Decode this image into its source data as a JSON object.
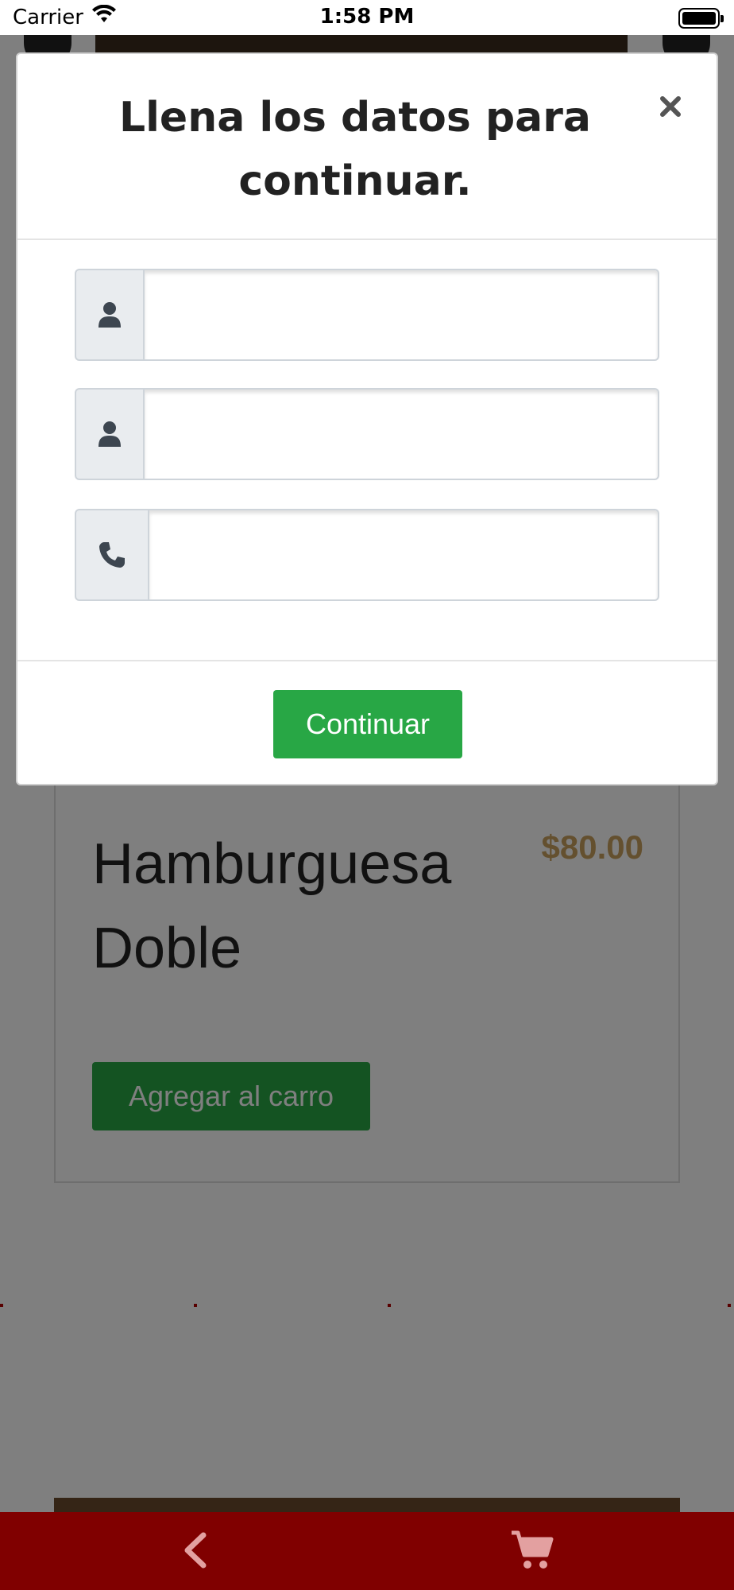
{
  "status_bar": {
    "carrier": "Carrier",
    "time": "1:58 PM"
  },
  "modal": {
    "title": "Llena los datos para continuar.",
    "close_icon": "times-icon",
    "fields": [
      {
        "icon": "user-icon",
        "value": "",
        "placeholder": ""
      },
      {
        "icon": "user-icon",
        "value": "",
        "placeholder": ""
      },
      {
        "icon": "phone-icon",
        "value": "",
        "placeholder": ""
      }
    ],
    "continue_label": "Continuar"
  },
  "product": {
    "name": "Hamburguesa Doble",
    "price": "$80.00",
    "add_label": "Agregar al carro"
  },
  "bottom_nav": {
    "back_icon": "chevron-left-icon",
    "cart_icon": "cart-icon"
  },
  "colors": {
    "accent_green": "#28a745",
    "nav_red": "#800000",
    "price_gold": "#c8a15e"
  }
}
